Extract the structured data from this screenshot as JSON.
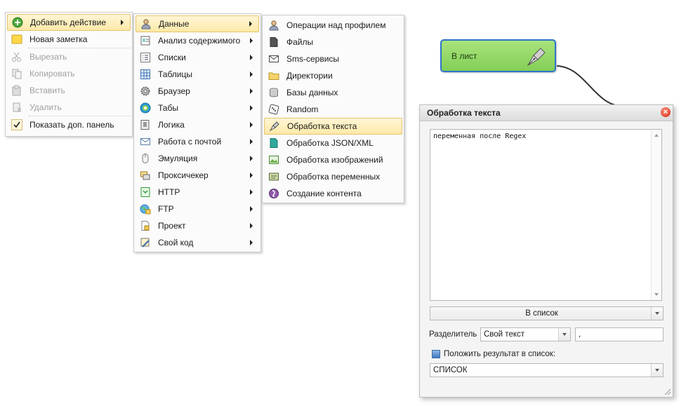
{
  "menu1": {
    "items": [
      {
        "label": "Добавить действие",
        "icon": "add-green-icon",
        "submenu": true,
        "selected": true,
        "disabled": false
      },
      {
        "label": "Новая заметка",
        "icon": "note-icon",
        "submenu": false,
        "selected": false,
        "disabled": false
      },
      {
        "label": "Вырезать",
        "icon": "scissors-icon",
        "submenu": false,
        "selected": false,
        "disabled": true
      },
      {
        "label": "Копировать",
        "icon": "copy-icon",
        "submenu": false,
        "selected": false,
        "disabled": true
      },
      {
        "label": "Вставить",
        "icon": "paste-icon",
        "submenu": false,
        "selected": false,
        "disabled": true
      },
      {
        "label": "Удалить",
        "icon": "delete-icon",
        "submenu": false,
        "selected": false,
        "disabled": true
      },
      {
        "label": "Показать доп. панель",
        "icon": "checkmark-icon",
        "submenu": false,
        "selected": false,
        "disabled": false
      }
    ]
  },
  "menu2": {
    "items": [
      {
        "label": "Данные",
        "icon": "user-data-icon",
        "selected": true
      },
      {
        "label": "Анализ содержимого",
        "icon": "analysis-icon",
        "selected": false
      },
      {
        "label": "Списки",
        "icon": "list-icon",
        "selected": false
      },
      {
        "label": "Таблицы",
        "icon": "table-icon",
        "selected": false
      },
      {
        "label": "Браузер",
        "icon": "gear-icon",
        "selected": false
      },
      {
        "label": "Табы",
        "icon": "tabs-icon",
        "selected": false
      },
      {
        "label": "Логика",
        "icon": "logic-icon",
        "selected": false
      },
      {
        "label": "Работа с почтой",
        "icon": "mail-icon",
        "selected": false
      },
      {
        "label": "Эмуляция",
        "icon": "mouse-icon",
        "selected": false
      },
      {
        "label": "Проксичекер",
        "icon": "proxy-icon",
        "selected": false
      },
      {
        "label": "HTTP",
        "icon": "http-icon",
        "selected": false
      },
      {
        "label": "FTP",
        "icon": "ftp-globe-icon",
        "selected": false
      },
      {
        "label": "Проект",
        "icon": "project-icon",
        "selected": false
      },
      {
        "label": "Свой код",
        "icon": "code-icon",
        "selected": false
      }
    ]
  },
  "menu3": {
    "items": [
      {
        "label": "Операции над профилем",
        "icon": "profile-icon",
        "selected": false
      },
      {
        "label": "Файлы",
        "icon": "file-icon",
        "selected": false
      },
      {
        "label": "Sms-сервисы",
        "icon": "envelope-icon",
        "selected": false
      },
      {
        "label": "Директории",
        "icon": "folder-icon",
        "selected": false
      },
      {
        "label": "Базы данных",
        "icon": "database-icon",
        "selected": false
      },
      {
        "label": "Random",
        "icon": "dice-icon",
        "selected": false
      },
      {
        "label": "Обработка текста",
        "icon": "pen-nib-icon",
        "selected": true
      },
      {
        "label": "Обработка JSON/XML",
        "icon": "json-file-icon",
        "selected": false
      },
      {
        "label": "Обработка изображений",
        "icon": "image-icon",
        "selected": false
      },
      {
        "label": "Обработка переменных",
        "icon": "variables-icon",
        "selected": false
      },
      {
        "label": "Создание контента",
        "icon": "content-icon",
        "selected": false
      }
    ]
  },
  "node": {
    "label": "В лист",
    "icon": "pen-nib-icon"
  },
  "dialog": {
    "title": "Обработка текста",
    "text_value": "переменная после Regex",
    "action_select": "В список",
    "separator_label": "Разделитель",
    "separator_type": "Свой текст",
    "separator_value": ",",
    "checkbox_label": "Положить результат в список:",
    "list_select": "СПИСОК"
  }
}
